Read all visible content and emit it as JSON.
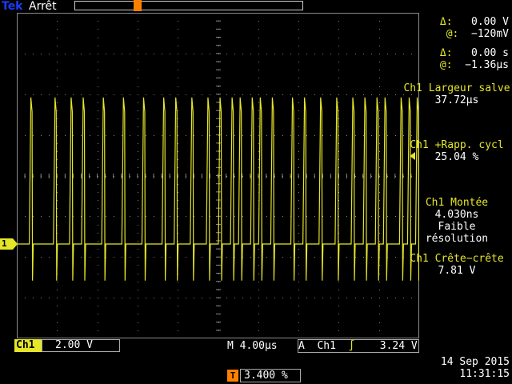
{
  "header": {
    "brand": "Tek",
    "run_state": "Arrêt"
  },
  "icons": {
    "trigger_position": "trigger-position-marker-icon",
    "channel_marker": "ch1-ground-marker-icon"
  },
  "colors": {
    "channel1": "#e5e52a",
    "trigger": "#ff7f00",
    "brand": "#1b3cff",
    "grid": "#8a8a8a"
  },
  "cursors": {
    "voltage": {
      "delta_symbol": "Δ:",
      "delta_value": "0.00 V",
      "at_symbol": "@:",
      "at_value": "−120mV"
    },
    "time": {
      "delta_symbol": "Δ:",
      "delta_value": "0.00 s",
      "at_symbol": "@:",
      "at_value": "−1.36µs"
    }
  },
  "measurements": [
    {
      "label": "Ch1 Largeur salve",
      "value": "37.72µs"
    },
    {
      "label": "Ch1 +Rapp. cycl",
      "value": "25.04 %"
    },
    {
      "label": "Ch1 Montée",
      "value": "4.030ns",
      "note1": "Faible",
      "note2": "résolution"
    },
    {
      "label": "Ch1 Crête−crête",
      "value": "7.81 V"
    }
  ],
  "channel": {
    "marker": "1",
    "name": "Ch1",
    "scale": "2.00 V"
  },
  "timebase": {
    "prefix": "M",
    "value": "4.00µs"
  },
  "trigger": {
    "mode": "A",
    "source": "Ch1",
    "slope_symbol": "∫",
    "level": "3.24 V",
    "position_icon": "T",
    "position": "3.400 %"
  },
  "datetime": {
    "date": "14 Sep  2015",
    "time": "11:31:15"
  },
  "waveform": {
    "baseline_div": 0,
    "high_div": 3.6,
    "low_div": -0.9,
    "pulse_times_div": [
      0.35,
      0.95,
      1.35,
      1.65,
      2.15,
      2.65,
      3.15,
      3.65,
      3.95,
      4.35,
      4.75,
      5.05,
      5.35,
      5.55,
      5.85,
      6.05,
      6.35,
      6.85,
      7.15,
      7.55,
      7.95,
      8.35,
      8.65,
      8.95,
      9.15,
      9.55,
      9.75,
      9.95
    ]
  }
}
